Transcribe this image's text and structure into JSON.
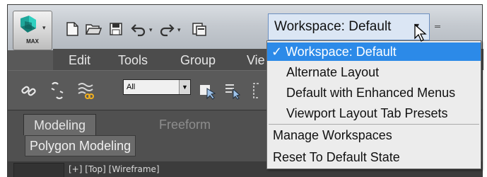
{
  "app": {
    "max_label": "MAX"
  },
  "quick_access": {
    "icons": [
      "new-file-icon",
      "open-folder-icon",
      "save-icon",
      "undo-icon",
      "redo-icon",
      "project-folder-icon"
    ]
  },
  "workspace": {
    "current": "Workspace: Default"
  },
  "menu": {
    "items": [
      "Edit",
      "Tools",
      "Group",
      "Vie"
    ]
  },
  "toolbar": {
    "selection_filter": "All"
  },
  "ribbon": {
    "tabs": [
      {
        "label": "Modeling",
        "active": true
      },
      {
        "label": "Freeform",
        "active": false
      }
    ],
    "panel": "Polygon Modeling"
  },
  "viewport": {
    "label": "[+] [Top] [Wireframe]"
  },
  "dropdown": {
    "checkmark": "✓",
    "workspaces": [
      {
        "label": "Workspace: Default",
        "checked": true
      },
      {
        "label": "Alternate Layout",
        "checked": false
      },
      {
        "label": "Default with Enhanced Menus",
        "checked": false
      },
      {
        "label": "Viewport Layout Tab Presets",
        "checked": false
      }
    ],
    "actions": [
      "Manage Workspaces",
      "Reset To Default State"
    ]
  },
  "colors": {
    "highlight": "#2c8ae8",
    "menu_bg": "#ececec",
    "app_bg": "#595959",
    "logo_teal": "#2fb5a8"
  }
}
